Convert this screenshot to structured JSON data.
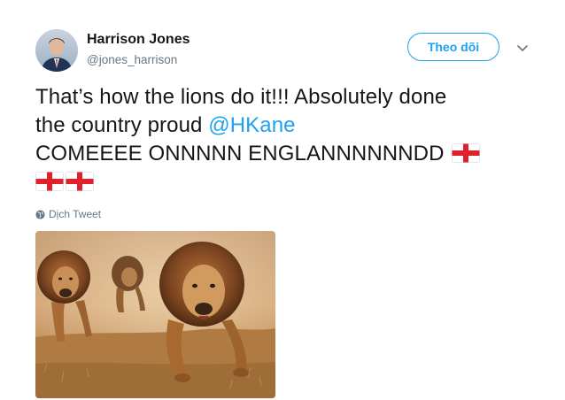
{
  "user": {
    "display_name": "Harrison Jones",
    "handle": "@jones_harrison",
    "avatar_icon": "profile-photo"
  },
  "follow_button_label": "Theo dõi",
  "menu_icon": "chevron-down-icon",
  "tweet": {
    "line1": "That’s how the lions do it!!! Absolutely done",
    "line2_prefix": "the country proud ",
    "mention": "@HKane",
    "line3": "COMEEEE ONNNNN ENGLANNNNNNDD",
    "flag_icon": "england-flag-icon",
    "flag_count_line3": 1,
    "flag_count_line4": 2
  },
  "translate_label": "Dịch Tweet",
  "media": {
    "icon": "lions-running-photo"
  },
  "colors": {
    "accent": "#1da1f2",
    "text": "#14171a",
    "muted": "#657786"
  }
}
